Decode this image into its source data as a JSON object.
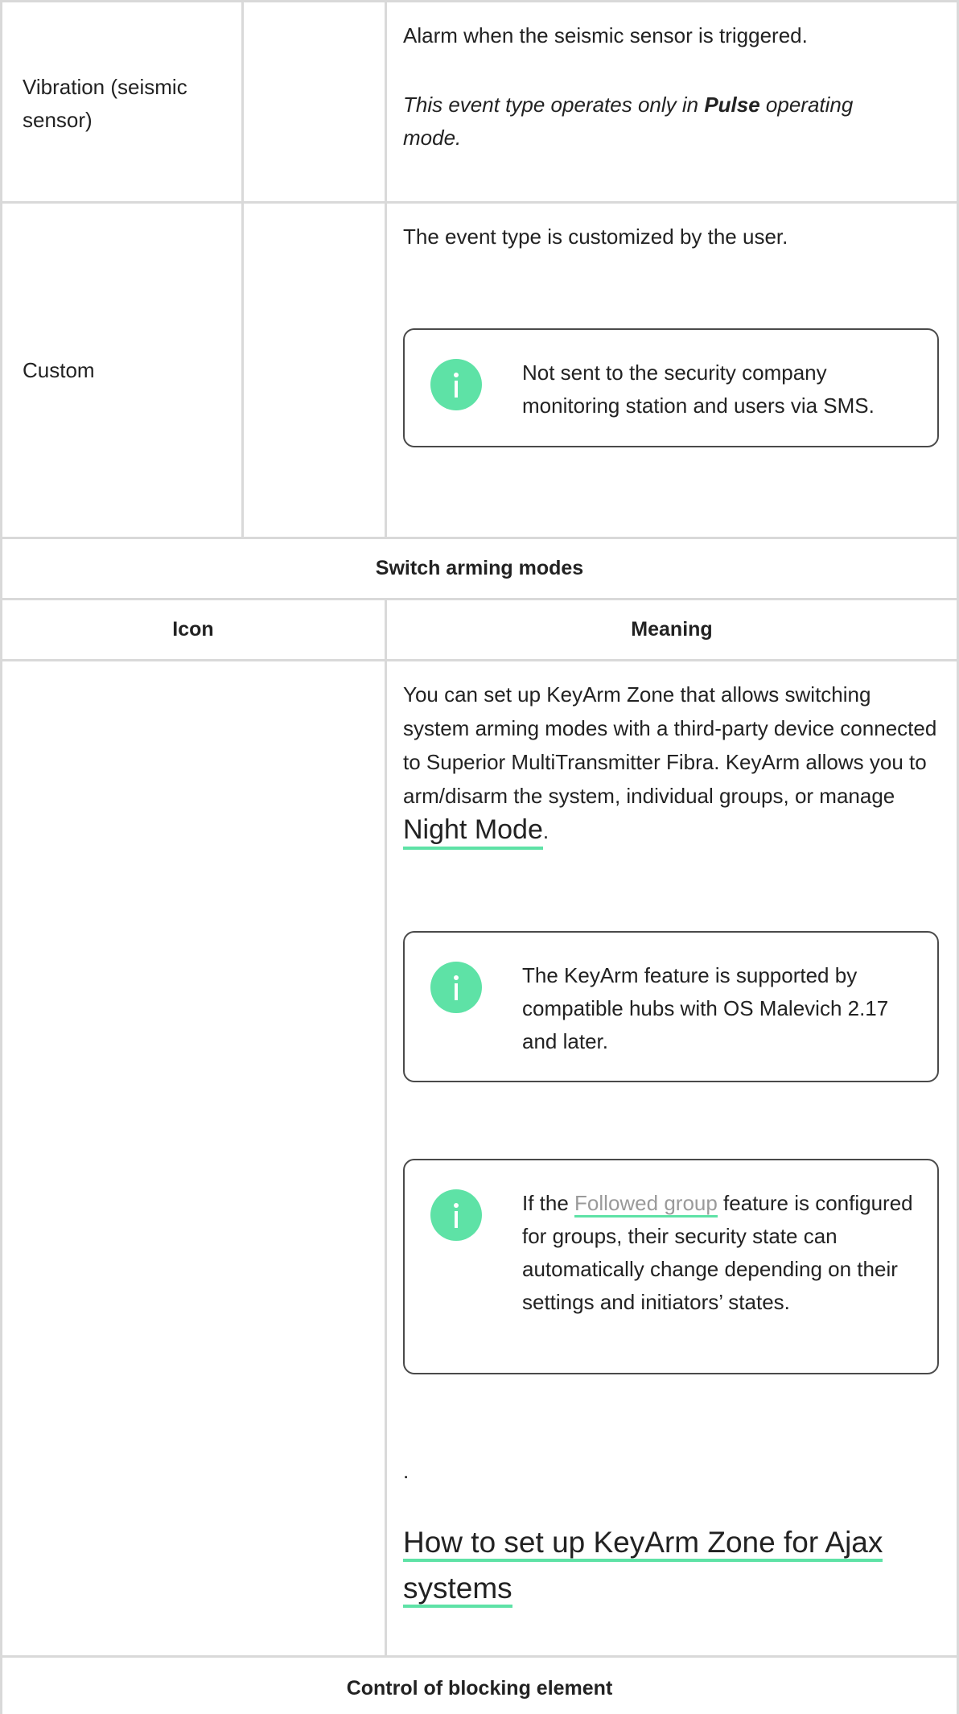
{
  "rows": [
    {
      "event": "Vibration (seismic sensor)",
      "description": "Alarm when the seismic sensor is triggered.",
      "note_prefix": "This event type operates only in ",
      "note_bold": "Pulse",
      "note_suffix": " operating mode."
    },
    {
      "event": "Custom",
      "description": "The event type is customized by the user.",
      "info": "Not sent to the security company monitoring station and users via SMS."
    }
  ],
  "switch_section": {
    "title": "Switch arming modes",
    "col_icon": "Icon",
    "col_meaning": "Meaning",
    "paragraph_before": "You can set up KeyArm Zone that allows switching system arming modes with a third-party device connected to Superior MultiTransmitter Fibra. KeyArm allows you to arm/disarm the system, individual groups, or manage ",
    "night_mode_link": "Night Mode",
    "paragraph_after": ".",
    "info_1": "The KeyArm feature is supported by compatible hubs with OS Malevich 2.17 and later.",
    "info_2_prefix": "If the ",
    "info_2_link": "Followed group",
    "info_2_suffix": " feature is configured for groups, their security state can automatically change depending on their settings and initiators’ states.",
    "dot": ".",
    "howto_link": "How to set up KeyArm Zone for Ajax systems"
  },
  "blocking_section": {
    "title": "Control of blocking element"
  },
  "colors": {
    "accent": "#5ee2a6",
    "border": "#d9d9d9",
    "note_border": "#4a4a4a",
    "link_gray": "#9a9a9a"
  },
  "icons": [
    "info-icon"
  ]
}
